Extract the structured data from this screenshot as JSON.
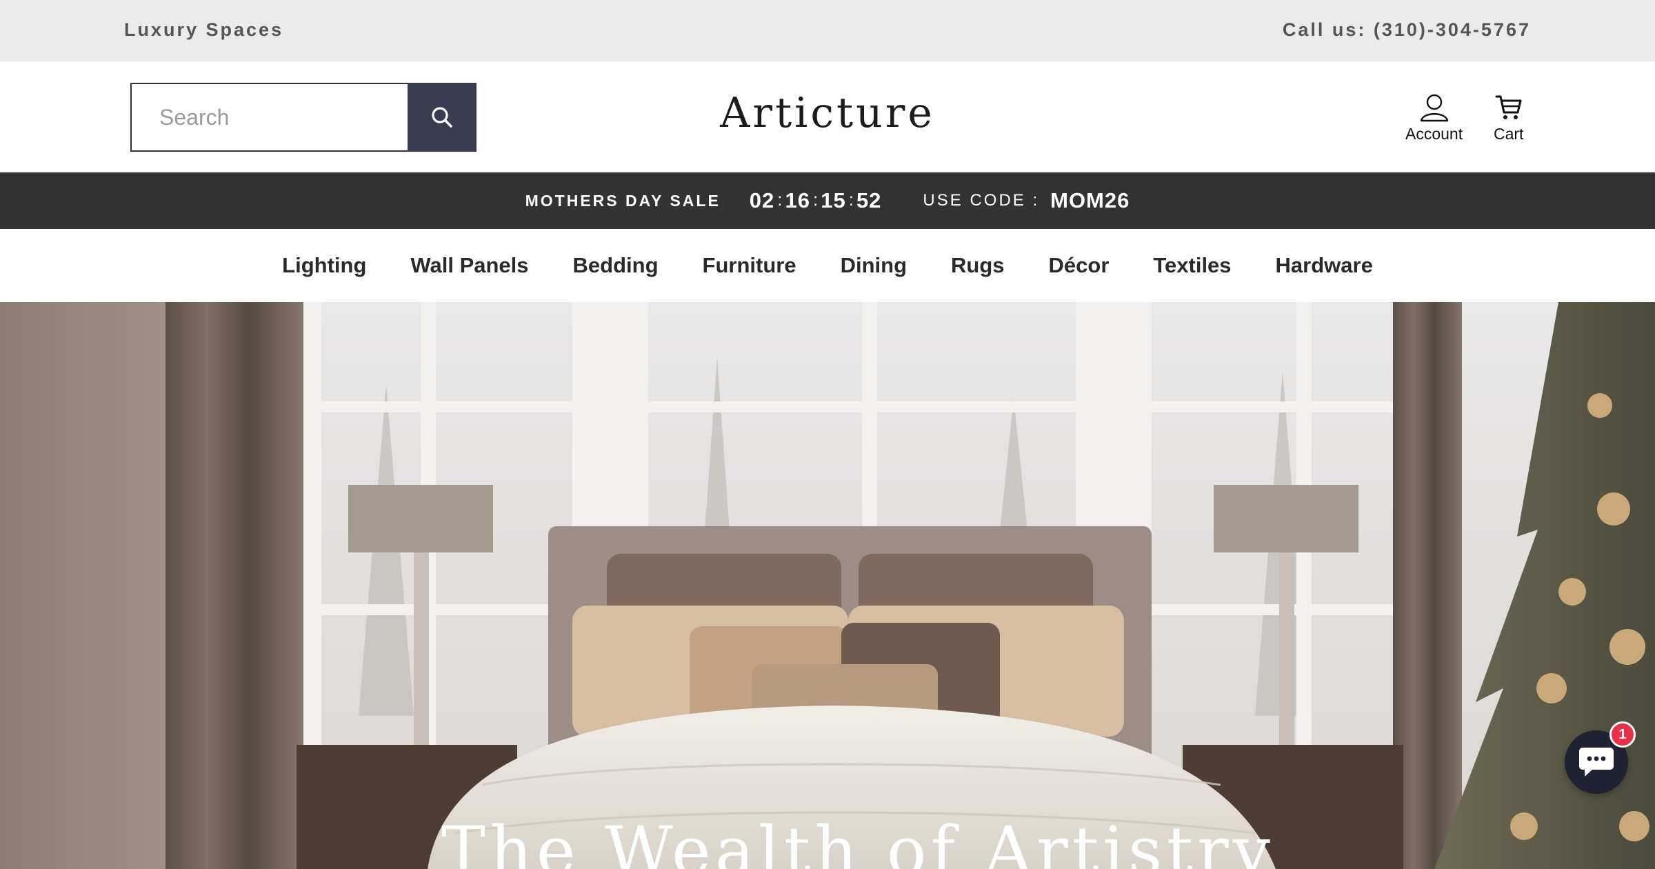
{
  "topbar": {
    "brand_tagline": "Luxury Spaces",
    "phone": "Call us: (310)-304-5767"
  },
  "header": {
    "search": {
      "placeholder": "Search",
      "value": "",
      "button_icon": "search-icon"
    },
    "logo": "Articture",
    "account_label": "Account",
    "account_icon": "user-icon",
    "cart_label": "Cart",
    "cart_icon": "cart-icon"
  },
  "sale": {
    "label": "MOTHERS DAY SALE",
    "countdown": {
      "days": "02",
      "hours": "16",
      "minutes": "15",
      "seconds": "52",
      "separator": ":"
    },
    "code_label": "USE CODE :",
    "code": "MOM26"
  },
  "nav": {
    "items": [
      "Lighting",
      "Wall Panels",
      "Bedding",
      "Furniture",
      "Dining",
      "Rugs",
      "Décor",
      "Textiles",
      "Hardware"
    ]
  },
  "hero": {
    "title": "The Wealth of Artistry",
    "image_subject": "luxury bedroom with tufted bed, lamps and decorated tree"
  },
  "chat": {
    "icon": "chat-bubble-icon",
    "badge_count": "1"
  },
  "colors": {
    "topbar_bg": "#ebebeb",
    "sale_bar_bg": "#333333",
    "search_button_bg": "#3a3d52",
    "chat_bg": "#1f2233",
    "badge_bg": "#e8304a"
  }
}
